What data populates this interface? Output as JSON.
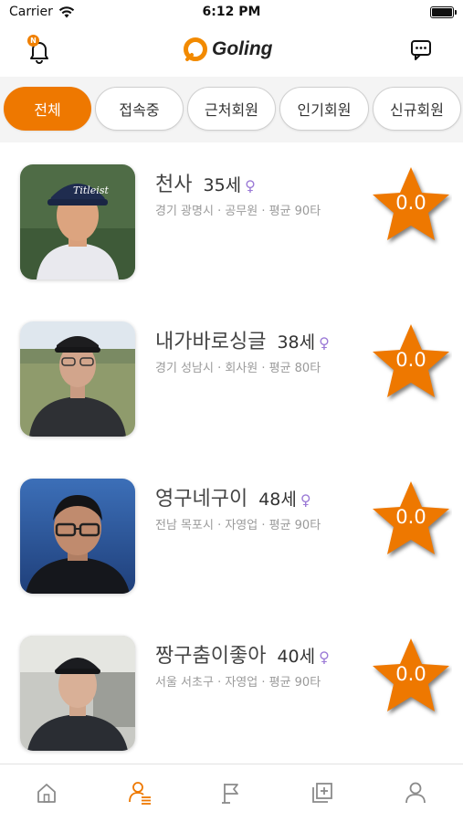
{
  "status_bar": {
    "carrier": "Carrier",
    "time": "6:12 PM"
  },
  "header": {
    "app_name": "Goling",
    "badge": "N"
  },
  "filters": [
    {
      "label": "전체"
    },
    {
      "label": "접속중"
    },
    {
      "label": "근처회원"
    },
    {
      "label": "인기회원"
    },
    {
      "label": "신규회원"
    }
  ],
  "members": [
    {
      "name": "천사",
      "age": "35세",
      "gender": "♀",
      "info": "경기 광명시 · 공무원 · 평균 90타",
      "rating": "0.0"
    },
    {
      "name": "내가바로싱글",
      "age": "38세",
      "gender": "♀",
      "info": "경기 성남시 · 회사원 · 평균 80타",
      "rating": "0.0"
    },
    {
      "name": "영구네구이",
      "age": "48세",
      "gender": "♀",
      "info": "전남 목포시 · 자영업 · 평균 90타",
      "rating": "0.0"
    },
    {
      "name": "짱구춤이좋아",
      "age": "40세",
      "gender": "♀",
      "info": "서울 서초구 · 자영업 · 평균 90타",
      "rating": "0.0"
    }
  ],
  "colors": {
    "accent": "#ee7800",
    "gender": "#9b7ad6"
  },
  "tabbar_icons": [
    "home-icon",
    "member-list-icon",
    "flag-icon",
    "add-post-icon",
    "profile-icon"
  ]
}
